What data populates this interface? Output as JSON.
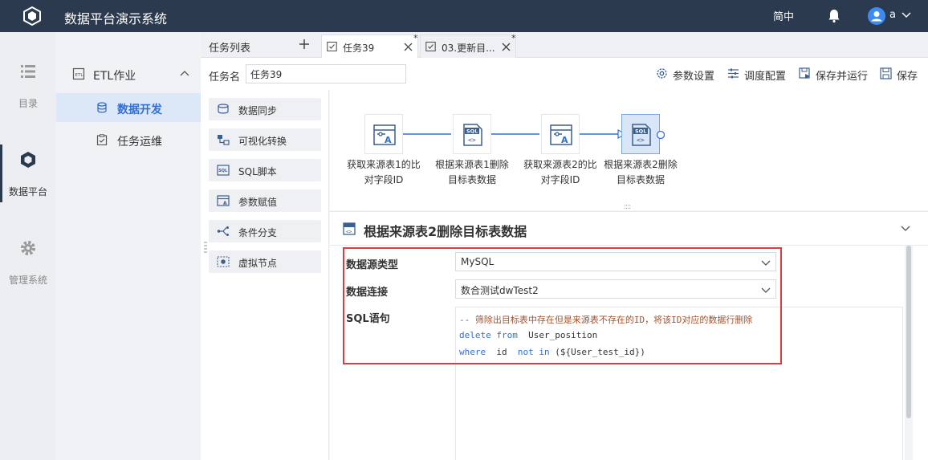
{
  "app": {
    "title": "数据平台演示系统",
    "lang": "简中",
    "user": "a"
  },
  "rail": [
    {
      "label": "目录",
      "icon": "list-icon"
    },
    {
      "label": "数据平台",
      "icon": "cube-icon",
      "active": true
    },
    {
      "label": "管理系统",
      "icon": "gear-icon"
    }
  ],
  "nav": {
    "group": "ETL作业",
    "items": [
      {
        "label": "数据开发",
        "active": true
      },
      {
        "label": "任务运维"
      }
    ]
  },
  "tabs": {
    "list_label": "任务列表",
    "items": [
      {
        "label": "任务39",
        "modified": "*",
        "active": true
      },
      {
        "label": "03.更新目...",
        "modified": "*"
      }
    ]
  },
  "toolbar": {
    "name_label": "任务名",
    "name_value": "任务39",
    "buttons": [
      "参数设置",
      "调度配置",
      "保存并运行",
      "保存"
    ]
  },
  "palette": [
    "数据同步",
    "可视化转换",
    "SQL脚本",
    "参数赋值",
    "条件分支",
    "虚拟节点"
  ],
  "flow": {
    "nodes": [
      {
        "line1": "获取来源表1的比",
        "line2": "对字段ID",
        "type": "param"
      },
      {
        "line1": "根据来源表1删除",
        "line2": "目标表数据",
        "type": "sql"
      },
      {
        "line1": "获取来源表2的比",
        "line2": "对字段ID",
        "type": "param"
      },
      {
        "line1": "根据来源表2删除",
        "line2": "目标表数据",
        "type": "sql",
        "selected": true
      }
    ]
  },
  "detail": {
    "title": "根据来源表2删除目标表数据",
    "datasource_type_label": "数据源类型",
    "datasource_type_value": "MySQL",
    "connection_label": "数据连接",
    "connection_value": "数合测试dwTest2",
    "sql_label": "SQL语句",
    "sql": {
      "comment": "-- 筛除出目标表中存在但是来源表不存在的ID，将该ID对应的数据行删除",
      "line2_kw": "delete from",
      "line2_rest": "  User_position",
      "line3_kw1": "where",
      "line3_mid": "  id  ",
      "line3_kw2": "not in",
      "line3_rest": " (${User_test_id})"
    }
  },
  "colors": {
    "topbar": "#2c3a4f",
    "accent": "#2f6fd6",
    "highlight": "#e0393e"
  }
}
